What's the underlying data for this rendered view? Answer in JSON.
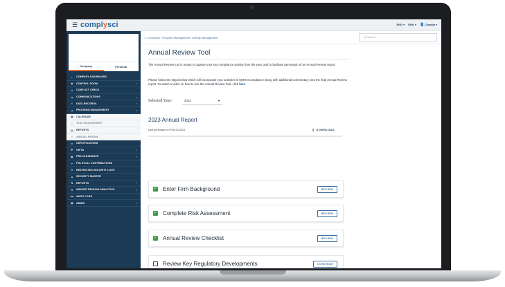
{
  "topbar": {
    "brand_main": "compl",
    "brand_accent": "y",
    "brand_tail": "sci",
    "lang1": "ENG ▾",
    "lang2": "ENG ▾",
    "user": "Claudia ▾"
  },
  "profile": {
    "tabs": [
      "Company",
      "Personal"
    ],
    "active_tab": "Company"
  },
  "sidebar": {
    "items": [
      {
        "label": "COMPANY DASHBOARD",
        "icon": "dashboard-icon",
        "chevron": false,
        "type": "main"
      },
      {
        "label": "CONTROL ROOM",
        "icon": "control-room-icon",
        "chevron": true,
        "type": "main"
      },
      {
        "label": "CONFLICT CHECK",
        "icon": "conflict-icon",
        "chevron": false,
        "type": "main"
      },
      {
        "label": "COMMUNICATIONS",
        "icon": "communications-icon",
        "chevron": true,
        "type": "main"
      },
      {
        "label": "DATA RECORDS",
        "icon": "data-records-icon",
        "chevron": true,
        "type": "main"
      },
      {
        "label": "PROGRAM MANAGEMENT",
        "icon": "program-management-icon",
        "chevron": true,
        "type": "main"
      },
      {
        "label": "CALENDAR",
        "icon": "calendar-icon",
        "chevron": false,
        "type": "sub"
      },
      {
        "label": "TASK MANAGEMENT",
        "icon": "task-icon",
        "chevron": false,
        "type": "sub-light"
      },
      {
        "label": "REPORTS",
        "icon": "reports-icon",
        "chevron": false,
        "type": "sub"
      },
      {
        "label": "ANNUAL REVIEW",
        "icon": "annual-review-icon",
        "chevron": false,
        "type": "sub-light"
      },
      {
        "label": "CERTIFICATIONS",
        "icon": "certifications-icon",
        "chevron": false,
        "type": "main"
      },
      {
        "label": "GIFTS",
        "icon": "gifts-icon",
        "chevron": true,
        "type": "main"
      },
      {
        "label": "PRE-CLEARANCE",
        "icon": "pre-clearance-icon",
        "chevron": true,
        "type": "main"
      },
      {
        "label": "POLITICAL CONTRIBUTIONS",
        "icon": "political-icon",
        "chevron": false,
        "type": "main"
      },
      {
        "label": "RESTRICTED SECURITY LISTS",
        "icon": "restricted-icon",
        "chevron": false,
        "type": "main"
      },
      {
        "label": "SECURITY MASTER",
        "icon": "security-master-icon",
        "chevron": false,
        "type": "main"
      },
      {
        "label": "REPORTS",
        "icon": "reports-chart-icon",
        "chevron": true,
        "type": "main"
      },
      {
        "label": "INSIDER TRADING ANALYTICS",
        "icon": "analytics-icon",
        "chevron": true,
        "type": "main"
      },
      {
        "label": "AUDIT LOGS",
        "icon": "audit-icon",
        "chevron": false,
        "type": "main"
      },
      {
        "label": "ADMIN",
        "icon": "admin-icon",
        "chevron": true,
        "type": "main"
      }
    ]
  },
  "main": {
    "breadcrumb": "/ Company / Program Management / Activity Management",
    "search_placeholder": "Q Search",
    "title": "Annual Review Tool",
    "intro": "The Annual Review tool is meant to capture your key compliance activity from the year, and to facilitate generation of an Annual Review report.",
    "intro2": "Please follow the steps below which will incorporate your activities in MyRIACompliance along with additional commentary, into the final Annual Review report. To watch a video on how to use the Annual Review Tool, click",
    "intro2_link": "here",
    "year_label": "Selected Year:",
    "year_value": "2023",
    "report_title": "2023 Annual Report",
    "report_meta": "Last generated on Feb-20-2023",
    "download_label": "DOWNLOAD"
  },
  "steps": [
    {
      "label": "Enter Firm Background",
      "checked": true,
      "action": "REVIEW"
    },
    {
      "label": "Complete Risk Assessment",
      "checked": true,
      "action": "REVIEW"
    },
    {
      "label": "Annual Review Checklist",
      "checked": true,
      "action": "REVIEW"
    },
    {
      "label": "Review Key Regulatory Developments",
      "checked": false,
      "action": "CONTINUE"
    }
  ]
}
